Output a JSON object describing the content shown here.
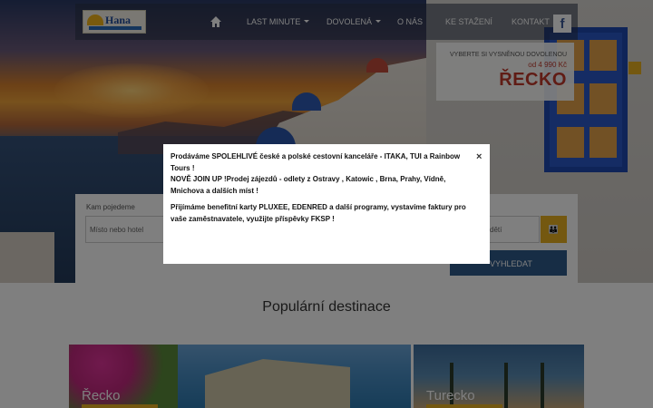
{
  "navbar": {
    "logo_text": "Hana",
    "items": [
      {
        "label": "LAST MINUTE",
        "dropdown": true
      },
      {
        "label": "DOVOLENÁ",
        "dropdown": true
      },
      {
        "label": "O NÁS",
        "dropdown": false
      },
      {
        "label": "KE STAŽENÍ",
        "dropdown": false
      },
      {
        "label": "KONTAKT",
        "dropdown": false
      }
    ],
    "facebook_glyph": "f"
  },
  "promo": {
    "tagline": "VYBERTE SI VYSNĚNOU DOVOLENOU",
    "price": "od 4 990 Kč",
    "destination": "ŘECKO"
  },
  "search": {
    "where_label": "Kam pojedeme",
    "where_placeholder": "Místo nebo hotel",
    "people_label": "",
    "people_value": "dětí",
    "submit_label": "VYHLEDAT"
  },
  "section": {
    "heading": "Populární destinace",
    "cards": [
      {
        "label": "Řecko"
      },
      {
        "label": "Turecko"
      }
    ]
  },
  "modal": {
    "paragraph1_line1": "Prodáváme SPOLEHLIVÉ české a polské cestovní kanceláře - ITAKA, TUI a Rainbow Tours !",
    "paragraph1_line2": "NOVĚ JOIN UP !Prodej zájezdů -  odlety z Ostravy , Katowic , Brna, Prahy, Vídně, Mnichova a dalších míst !",
    "paragraph2": "Přijímáme benefitní karty PLUXEE, EDENRED a další programy,  vystavíme faktury pro vaše zaměstnavatele, využijte  příspěvky FKSP !",
    "close_glyph": "×"
  },
  "colors": {
    "accent": "#e8b020",
    "promo_red": "#c0392b",
    "button_blue": "#2f5a8a"
  }
}
